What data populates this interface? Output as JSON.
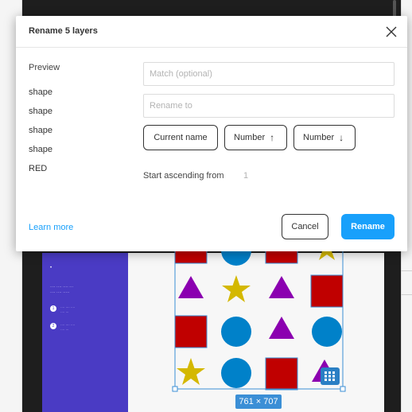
{
  "dialog": {
    "title": "Rename 5 layers",
    "close_icon": "close-icon"
  },
  "preview": {
    "label": "Preview",
    "layers": [
      "shape",
      "shape",
      "shape",
      "shape",
      "RED"
    ]
  },
  "fields": {
    "match_placeholder": "Match (optional)",
    "match_value": "",
    "rename_placeholder": "Rename to",
    "rename_value": ""
  },
  "tokens": {
    "current_name": "Current name",
    "number_up": "Number",
    "number_up_icon": "arrow-up-icon",
    "number_down": "Number",
    "number_down_icon": "arrow-down-icon"
  },
  "start": {
    "label": "Start ascending from",
    "value": "1"
  },
  "footer": {
    "learn_more": "Learn more",
    "cancel": "Cancel",
    "rename": "Rename"
  },
  "canvas": {
    "selection_size": "761 × 707",
    "grid_icon": "grid-icon"
  },
  "colors": {
    "accent": "#18a0fb",
    "panel": "#4a3bc4",
    "square": "#c00000",
    "circle": "#0081c9",
    "triangle": "#8b00b0",
    "star": "#d4b800",
    "selection": "#3b8fd6"
  }
}
